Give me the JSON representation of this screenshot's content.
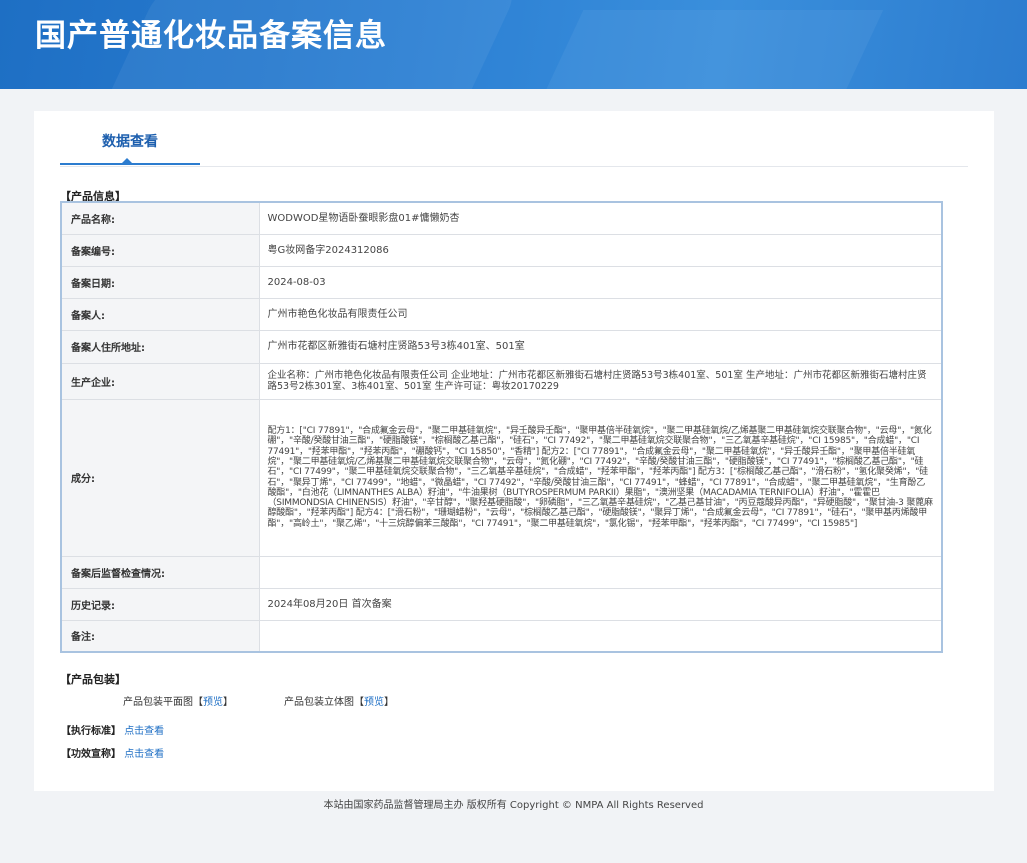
{
  "header": {
    "title": "国产普通化妆品备案信息"
  },
  "tabs": [
    {
      "label": "数据查看"
    }
  ],
  "product_info": {
    "section_title": "【产品信息】",
    "rows": [
      {
        "label": "产品名称:",
        "value": "WODWOD星物语卧蚕眼影盘01#慵懒奶杏"
      },
      {
        "label": "备案编号:",
        "value": "粤G妆网备字2024312086"
      },
      {
        "label": "备案日期:",
        "value": "2024-08-03"
      },
      {
        "label": "备案人:",
        "value": "广州市艳色化妆品有限责任公司"
      },
      {
        "label": "备案人住所地址:",
        "value": "广州市花都区新雅街石塘村庄贤路53号3栋401室、501室"
      },
      {
        "label": "生产企业:",
        "value": "企业名称：广州市艳色化妆品有限责任公司 企业地址：广州市花都区新雅街石塘村庄贤路53号3栋401室、501室 生产地址：广州市花都区新雅街石塘村庄贤路53号2栋301室、3栋401室、501室 生产许可证：粤妆20170229"
      },
      {
        "label": "成分:",
        "value": "配方1：[\"CI 77891\"，\"合成氟金云母\"，\"聚二甲基硅氧烷\"，\"异壬酸异壬酯\"，\"聚甲基倍半硅氧烷\"，\"聚二甲基硅氧烷/乙烯基聚二甲基硅氧烷交联聚合物\"，\"云母\"，\"氮化硼\"，\"辛酸/癸酸甘油三酯\"，\"硬脂酸镁\"，\"棕榈酸乙基己酯\"，\"硅石\"，\"CI 77492\"，\"聚二甲基硅氧烷交联聚合物\"，\"三乙氧基辛基硅烷\"，\"CI 15985\"，\"合成蜡\"，\"CI 77491\"，\"羟苯甲酯\"，\"羟苯丙酯\"，\"硼酸钙\"，\"CI 15850\"，\"香精\"] 配方2：[\"CI 77891\"，\"合成氟金云母\"，\"聚二甲基硅氧烷\"，\"异壬酸异壬酯\"，\"聚甲基倍半硅氧烷\"，\"聚二甲基硅氧烷/乙烯基聚二甲基硅氧烷交联聚合物\"，\"云母\"，\"氮化硼\"，\"CI 77492\"，\"辛酸/癸酸甘油三酯\"，\"硬脂酸镁\"，\"CI 77491\"，\"棕榈酸乙基己酯\"，\"硅石\"，\"CI 77499\"，\"聚二甲基硅氧烷交联聚合物\"，\"三乙氧基辛基硅烷\"，\"合成蜡\"，\"羟苯甲酯\"，\"羟苯丙酯\"] 配方3：[\"棕榈酸乙基己酯\"，\"滑石粉\"，\"氢化聚癸烯\"，\"硅石\"，\"聚异丁烯\"，\"CI 77499\"，\"地蜡\"，\"微晶蜡\"，\"CI 77492\"，\"辛酸/癸酸甘油三酯\"，\"CI 77491\"，\"蜂蜡\"，\"CI 77891\"，\"合成蜡\"，\"聚二甲基硅氧烷\"，\"生育酚乙酸酯\"，\"白池花（LIMNANTHES ALBA）籽油\"，\"牛油果树（BUTYROSPERMUM PARKII）果脂\"，\"澳洲坚果（MACADAMIA TERNIFOLIA）籽油\"，\"霍霍巴（SIMMONDSIA CHINENSIS）籽油\"，\"辛甘醇\"，\"聚羟基硬脂酸\"，\"卵磷脂\"，\"三乙氧基辛基硅烷\"，\"乙基己基甘油\"，\"丙豆蔻酸异丙酯\"，\"异硬脂酸\"，\"聚甘油-3 聚蓖麻醇酸酯\"，\"羟苯丙酯\"] 配方4：[\"滑石粉\"，\"珊瑚蜡粉\"，\"云母\"，\"棕榈酸乙基己酯\"，\"硬脂酸镁\"，\"聚异丁烯\"，\"合成氟金云母\"，\"CI 77891\"，\"硅石\"，\"聚甲基丙烯酸甲酯\"，\"高岭土\"，\"聚乙烯\"，\"十三烷醇偏苯三酸酯\"，\"CI 77491\"，\"聚二甲基硅氧烷\"，\"氯化锡\"，\"羟苯甲酯\"，\"羟苯丙酯\"，\"CI 77499\"，\"CI 15985\"]"
      },
      {
        "label": "备案后监督检查情况:",
        "value": ""
      },
      {
        "label": "历史记录:",
        "value": "2024年08月20日 首次备案"
      },
      {
        "label": "备注:",
        "value": ""
      }
    ]
  },
  "packaging": {
    "section_title": "【产品包装】",
    "flat_label": "产品包装平面图",
    "flat_link": "预览",
    "solid_label": "产品包装立体图",
    "solid_link": "预览",
    "bracket_open": "【",
    "bracket_close": "】"
  },
  "standard": {
    "label": "【执行标准】",
    "link": "点击查看"
  },
  "efficacy": {
    "label": "【功效宣称】",
    "link": "点击查看"
  },
  "footer": {
    "text": "本站由国家药品监督管理局主办 版权所有 Copyright © NMPA All Rights Reserved"
  }
}
